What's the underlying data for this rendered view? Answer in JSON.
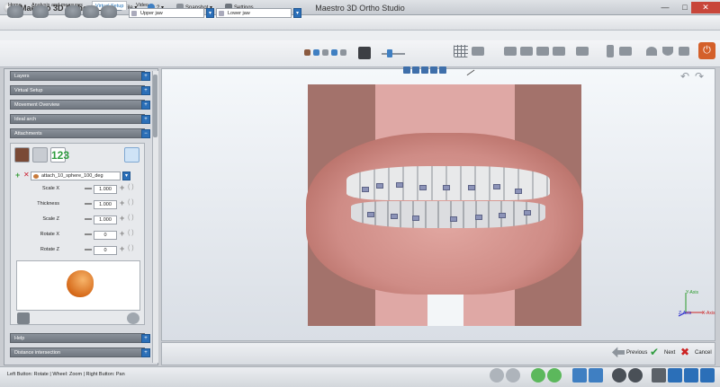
{
  "window": {
    "brand": "Maestro 3D Ortho Studio",
    "title": "Maestro 3D Ortho Studio",
    "controls": {
      "minimize": "—",
      "maximize": "□",
      "close": "✕"
    }
  },
  "menu": [
    {
      "label": "File"
    },
    {
      "label": "?"
    },
    {
      "label": "Snapshot"
    },
    {
      "label": "Settings"
    }
  ],
  "tabs": [
    {
      "label": "Home"
    },
    {
      "label": "Analysis and measures"
    },
    {
      "label": "Virtual Setup"
    },
    {
      "label": "Video"
    }
  ],
  "toolbar": {
    "upper_jaw": "Upper jaw",
    "lower_jaw": "Lower jaw",
    "power": "⏻"
  },
  "sections": [
    {
      "label": "Layers"
    },
    {
      "label": "Virtual Setup"
    },
    {
      "label": "Movement Overview"
    },
    {
      "label": "Ideal arch"
    },
    {
      "label": "Attachments"
    }
  ],
  "attachments": {
    "tool_label_123": "123",
    "selected": "attach_10_sphere_100_deg",
    "params": [
      {
        "label": "Scale X",
        "value": "1.000"
      },
      {
        "label": "Thickness",
        "value": "1.000"
      },
      {
        "label": "Scale Z",
        "value": "1.000"
      },
      {
        "label": "Rotate X",
        "value": "0"
      },
      {
        "label": "Rotate Z",
        "value": "0"
      }
    ]
  },
  "bottom_sections": [
    {
      "label": "Help"
    },
    {
      "label": "Distance intersection"
    }
  ],
  "viewport": {
    "axis_y": "Y-Axis",
    "axis_x": "X-Axis",
    "axis_z": "Z-Axis"
  },
  "nav": {
    "previous": "Previous",
    "next": "Next",
    "cancel": "Cancel"
  },
  "status": {
    "text": "Left Button: Rotate | Wheel: Zoom | Right Button: Pan"
  }
}
